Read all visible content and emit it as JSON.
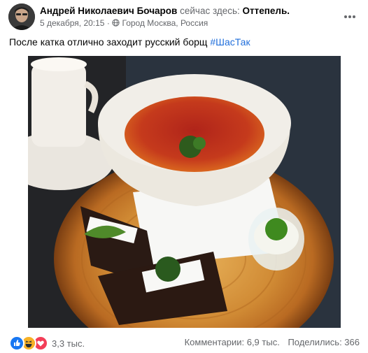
{
  "post": {
    "author": "Андрей Николаевич Бочаров",
    "checkin_prefix": "сейчас здесь:",
    "place": "Оттепель.",
    "date": "5 декабря, 20:15",
    "separator": "·",
    "location": "Город Москва, Россия",
    "text": "После катка отлично заходит русский борщ",
    "hashtag": "#ШасТак"
  },
  "footer": {
    "reaction_count": "3,3 тыс.",
    "comments": "Комментарии: 6,9 тыс.",
    "shares": "Поделились: 366"
  },
  "icons": [
    "avatar",
    "globe-icon",
    "more-options-icon",
    "like-reaction-icon",
    "haha-reaction-icon",
    "love-reaction-icon"
  ],
  "colors": {
    "link": "#216fdb",
    "secondary_text": "#65676b",
    "like": "#1877f2",
    "love": "#f33e58",
    "haha": "#f7b125"
  }
}
